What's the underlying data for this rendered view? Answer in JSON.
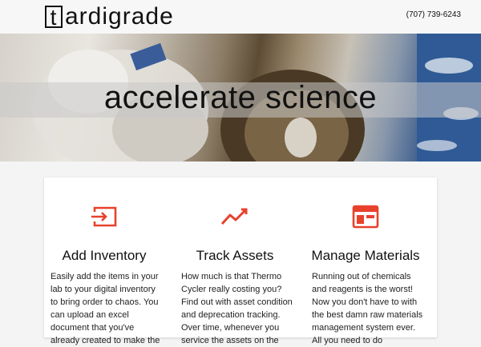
{
  "header": {
    "logo_initial": "t",
    "logo_rest": "ardigrade",
    "phone": "(707) 739-6243"
  },
  "hero": {
    "title": "accelerate science"
  },
  "features": [
    {
      "icon": "import-icon",
      "title": "Add Inventory",
      "body": "Easily add the items in your lab to your digital inventory to bring order to chaos. You can upload an excel document that you've already created to make the"
    },
    {
      "icon": "trend-line-icon",
      "title": "Track Assets",
      "body": "How much is that Thermo Cycler really costing you? Find out with asset condition and deprecation tracking. Over time, whenever you service the assets on the"
    },
    {
      "icon": "browser-window-icon",
      "title": "Manage Materials",
      "body": "Running out of chemicals and reagents is the worst! Now you don't have to with the best damn raw materials management system ever. All you need to do"
    }
  ],
  "colors": {
    "accent": "#e8412c"
  }
}
